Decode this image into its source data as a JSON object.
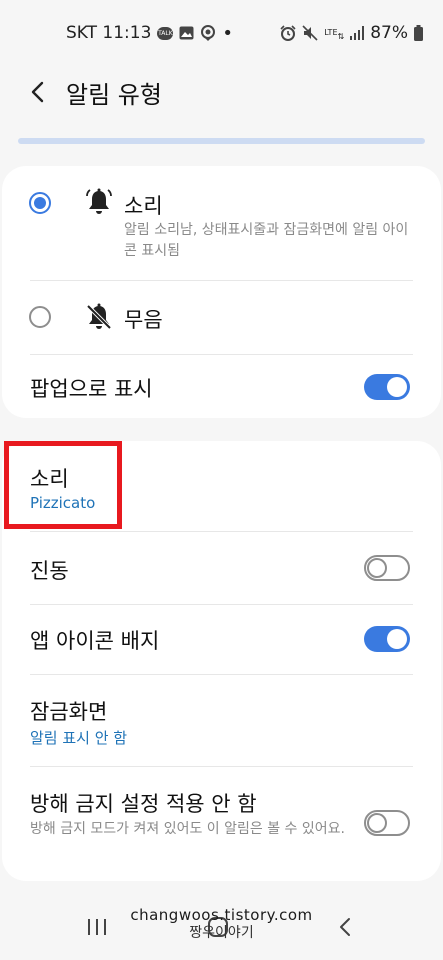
{
  "status_bar": {
    "carrier_time": "SKT 11:13",
    "network": "LTE",
    "battery": "87%"
  },
  "header": {
    "title": "알림 유형"
  },
  "options": [
    {
      "title": "소리",
      "description": "알림 소리남, 상태표시줄과 잠금화면에 알림 아이콘 표시됨",
      "selected": true
    },
    {
      "title": "무음",
      "selected": false
    }
  ],
  "popup": {
    "label": "팝업으로 표시",
    "enabled": true
  },
  "settings": {
    "sound": {
      "label": "소리",
      "value": "Pizzicato"
    },
    "vibration": {
      "label": "진동",
      "enabled": false
    },
    "badge": {
      "label": "앱 아이콘 배지",
      "enabled": true
    },
    "lock_screen": {
      "label": "잠금화면",
      "value": "알림 표시 안 함"
    },
    "dnd": {
      "label": "방해 금지 설정 적용 안 함",
      "description": "방해 금지 모드가 켜져 있어도 이 알림은 볼 수 있어요.",
      "enabled": false
    }
  },
  "watermark": {
    "url": "changwoos.tistory.com",
    "name": "짱우이야기"
  },
  "colors": {
    "accent": "#3a7ae0",
    "link": "#1f73b7",
    "highlight": "#e8191f"
  }
}
